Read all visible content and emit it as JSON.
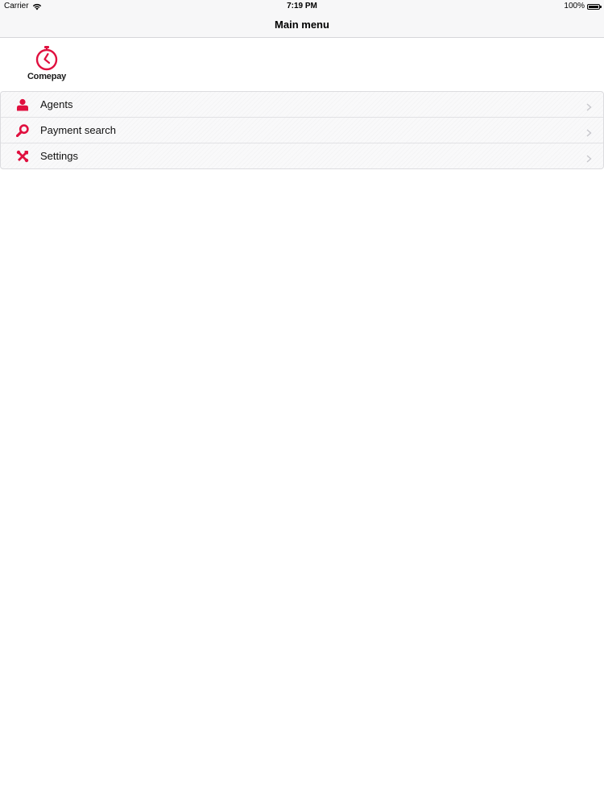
{
  "status_bar": {
    "carrier": "Carrier",
    "time": "7:19 PM",
    "battery": "100%"
  },
  "nav": {
    "title": "Main menu"
  },
  "logo": {
    "text": "Comepay"
  },
  "menu": {
    "items": [
      {
        "label": "Agents",
        "icon": "person-icon"
      },
      {
        "label": "Payment search",
        "icon": "search-icon"
      },
      {
        "label": "Settings",
        "icon": "tools-icon"
      }
    ]
  },
  "colors": {
    "accent": "#e0103f",
    "chevron": "#c7c7cc",
    "bar_background": "#f7f7f8"
  }
}
